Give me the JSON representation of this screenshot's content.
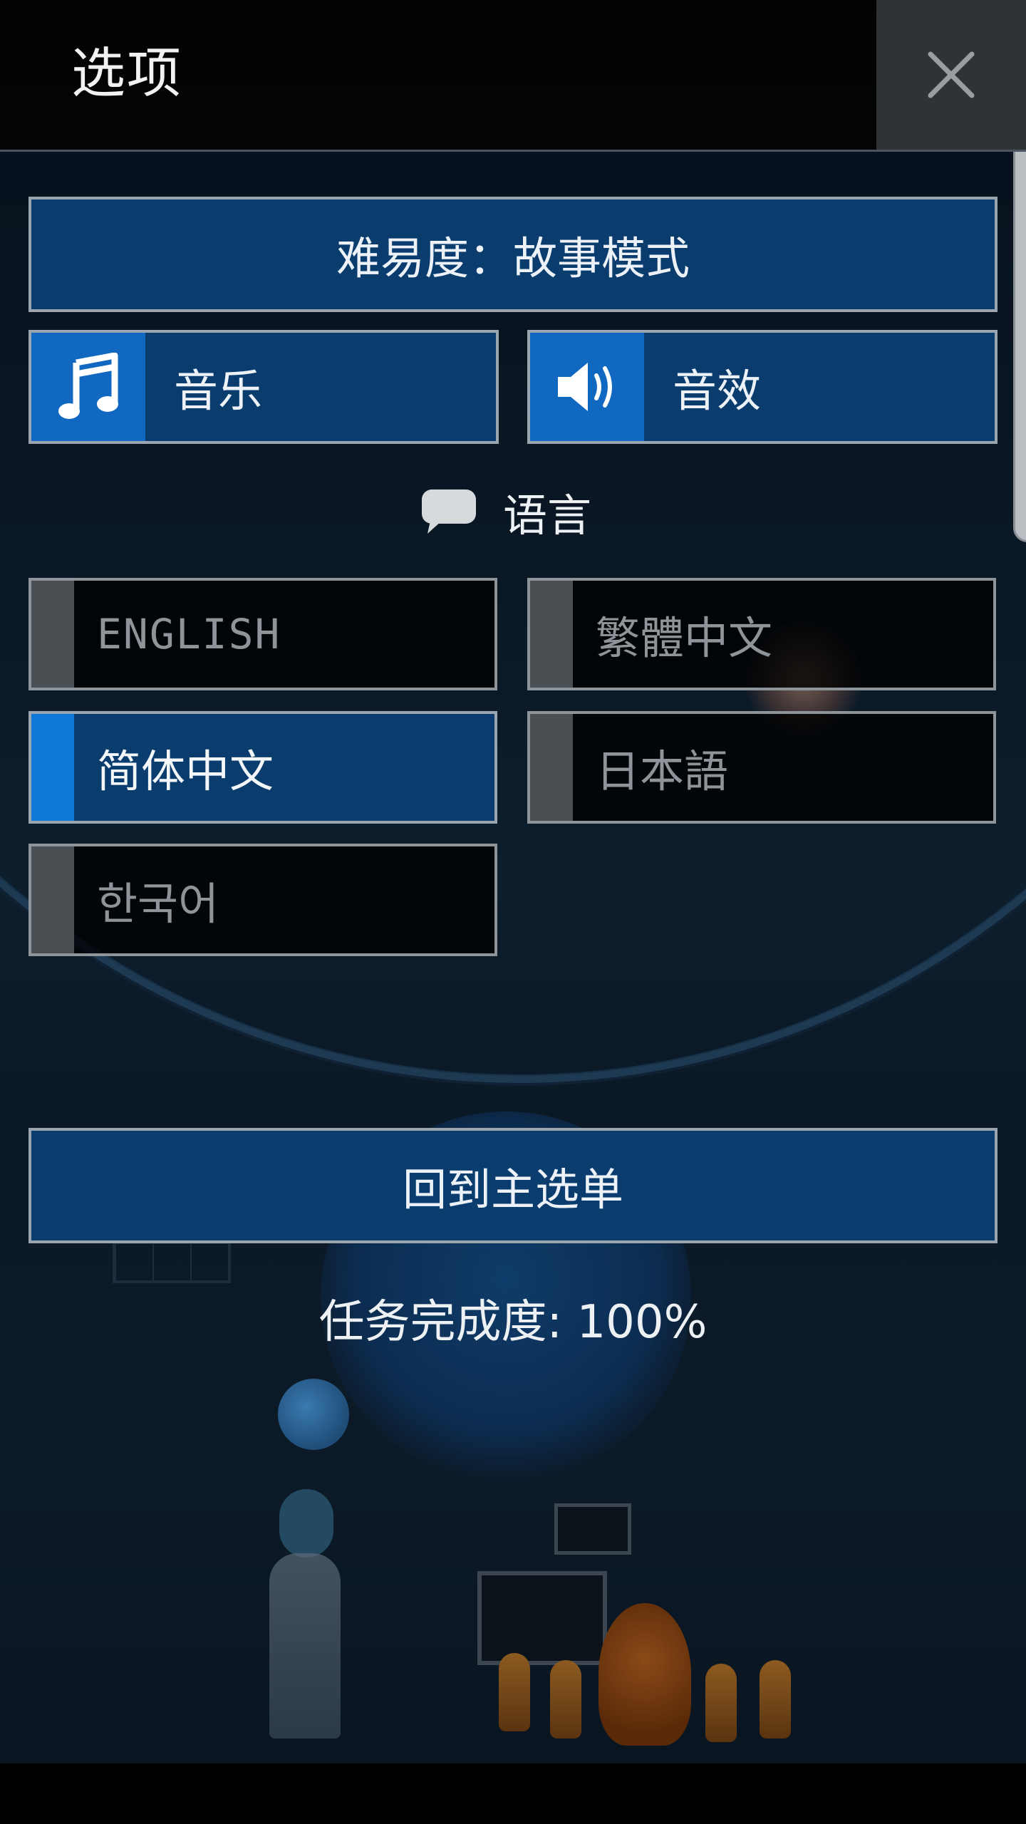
{
  "header": {
    "title": "选项",
    "close_icon": "close-icon"
  },
  "settings": {
    "difficulty_label": "难易度：故事模式",
    "music_label": "音乐",
    "music_icon": "music-note-icon",
    "sfx_label": "音效",
    "sfx_icon": "speaker-icon"
  },
  "language": {
    "heading": "语言",
    "heading_icon": "speech-bubble-icon",
    "options": [
      {
        "label": "ENGLISH",
        "selected": false
      },
      {
        "label": "繁體中文",
        "selected": false
      },
      {
        "label": "简体中文",
        "selected": true
      },
      {
        "label": "日本語",
        "selected": false
      },
      {
        "label": "한국어",
        "selected": false
      }
    ]
  },
  "main_menu_label": "回到主选单",
  "completion": {
    "label": "任务完成度: 100%",
    "percent": 100
  },
  "colors": {
    "panel_blue": "#0a3c6e",
    "accent_blue": "#1068c0",
    "selected_stripe": "#0f78d8",
    "unselected_stripe": "#4a4f54",
    "border": "#9aa5b0"
  }
}
